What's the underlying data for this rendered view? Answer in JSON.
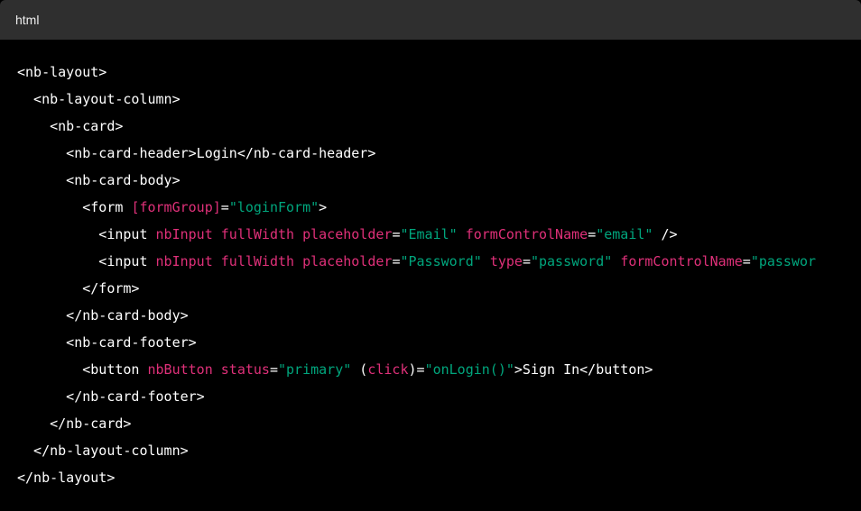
{
  "header": {
    "language": "html"
  },
  "colors": {
    "plain": "#ffffff",
    "attribute": "#df3079",
    "string": "#00a67d",
    "header_bg": "#2f2f2f",
    "code_bg": "#000000"
  },
  "code": {
    "lines": [
      [
        {
          "t": "p",
          "v": "<nb-layout>"
        }
      ],
      [
        {
          "t": "p",
          "v": "  <nb-layout-column>"
        }
      ],
      [
        {
          "t": "p",
          "v": "    <nb-card>"
        }
      ],
      [
        {
          "t": "p",
          "v": "      <nb-card-header>Login</nb-card-header>"
        }
      ],
      [
        {
          "t": "p",
          "v": "      <nb-card-body>"
        }
      ],
      [
        {
          "t": "p",
          "v": "        <form "
        },
        {
          "t": "a",
          "v": "[formGroup]"
        },
        {
          "t": "p",
          "v": "="
        },
        {
          "t": "s",
          "v": "\"loginForm\""
        },
        {
          "t": "p",
          "v": ">"
        }
      ],
      [
        {
          "t": "p",
          "v": "          <input "
        },
        {
          "t": "a",
          "v": "nbInput fullWidth placeholder"
        },
        {
          "t": "p",
          "v": "="
        },
        {
          "t": "s",
          "v": "\"Email\""
        },
        {
          "t": "p",
          "v": " "
        },
        {
          "t": "a",
          "v": "formControlName"
        },
        {
          "t": "p",
          "v": "="
        },
        {
          "t": "s",
          "v": "\"email\""
        },
        {
          "t": "p",
          "v": " />"
        }
      ],
      [
        {
          "t": "p",
          "v": "          <input "
        },
        {
          "t": "a",
          "v": "nbInput fullWidth placeholder"
        },
        {
          "t": "p",
          "v": "="
        },
        {
          "t": "s",
          "v": "\"Password\""
        },
        {
          "t": "p",
          "v": " "
        },
        {
          "t": "a",
          "v": "type"
        },
        {
          "t": "p",
          "v": "="
        },
        {
          "t": "s",
          "v": "\"password\""
        },
        {
          "t": "p",
          "v": " "
        },
        {
          "t": "a",
          "v": "formControlName"
        },
        {
          "t": "p",
          "v": "="
        },
        {
          "t": "s",
          "v": "\"passwor"
        }
      ],
      [
        {
          "t": "p",
          "v": "        </form>"
        }
      ],
      [
        {
          "t": "p",
          "v": "      </nb-card-body>"
        }
      ],
      [
        {
          "t": "p",
          "v": "      <nb-card-footer>"
        }
      ],
      [
        {
          "t": "p",
          "v": "        <button "
        },
        {
          "t": "a",
          "v": "nbButton status"
        },
        {
          "t": "p",
          "v": "="
        },
        {
          "t": "s",
          "v": "\"primary\""
        },
        {
          "t": "p",
          "v": " ("
        },
        {
          "t": "a",
          "v": "click"
        },
        {
          "t": "p",
          "v": ")="
        },
        {
          "t": "s",
          "v": "\"onLogin()\""
        },
        {
          "t": "p",
          "v": ">Sign In</button>"
        }
      ],
      [
        {
          "t": "p",
          "v": "      </nb-card-footer>"
        }
      ],
      [
        {
          "t": "p",
          "v": "    </nb-card>"
        }
      ],
      [
        {
          "t": "p",
          "v": "  </nb-layout-column>"
        }
      ],
      [
        {
          "t": "p",
          "v": "</nb-layout>"
        }
      ]
    ]
  }
}
